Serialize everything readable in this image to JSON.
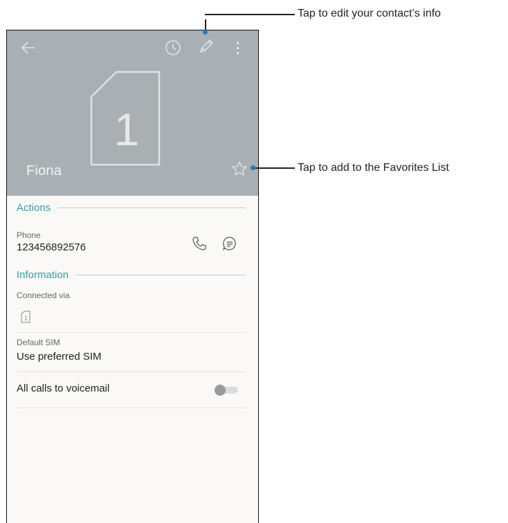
{
  "contact": {
    "name": "Fiona",
    "avatar_label": "1"
  },
  "sections": {
    "actions_title": "Actions",
    "information_title": "Information"
  },
  "phone": {
    "label": "Phone",
    "number": "123456892576"
  },
  "information": {
    "connected_via_label": "Connected via",
    "sim_badge": "1",
    "default_sim_label": "Default SIM",
    "default_sim_value": "Use preferred SIM",
    "voicemail_label": "All calls to voicemail",
    "voicemail_toggle_on": false
  },
  "callouts": {
    "edit": "Tap to edit your contact’s info",
    "favorite": "Tap to add to the Favorites List"
  },
  "icons": [
    "back-arrow-icon",
    "history-icon",
    "edit-pencil-icon",
    "more-vert-icon",
    "sim-card-icon",
    "star-outline-icon",
    "phone-call-icon",
    "message-icon"
  ],
  "colors": {
    "header_bg": "#a9afb2",
    "accent_teal": "#3e9aa0",
    "callout_dot": "#2a7bb8"
  }
}
